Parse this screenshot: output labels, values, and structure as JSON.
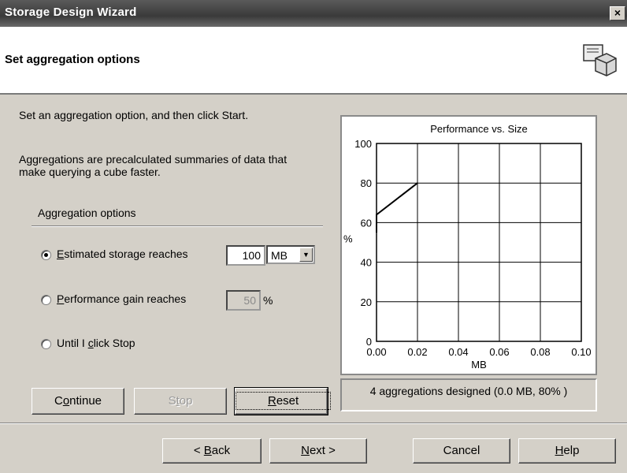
{
  "window": {
    "title": "Storage Design Wizard",
    "close": "×"
  },
  "header": {
    "title": "Set aggregation options"
  },
  "instructions": {
    "line1": "Set an aggregation option, and then click Start.",
    "line2a": "Aggregations are precalculated summaries of data that",
    "line2b": "make querying a cube faster."
  },
  "options": {
    "group_label": "Aggregation options",
    "storage": {
      "label_pre": "",
      "mnemonic": "E",
      "label_post": "stimated storage reaches",
      "value": "100",
      "unit": "MB",
      "selected": true
    },
    "performance": {
      "mnemonic": "P",
      "label_post": "erformance gain reaches",
      "value": "50",
      "unit_symbol": "%"
    },
    "until_stop": {
      "label_pre": "Until I ",
      "mnemonic": "c",
      "label_post": "lick Stop"
    }
  },
  "actions": {
    "continue": {
      "pre": "C",
      "mnemonic": "o",
      "post": "ntinue"
    },
    "stop": {
      "pre": "S",
      "mnemonic": "t",
      "post": "op"
    },
    "reset": {
      "pre": "",
      "mnemonic": "R",
      "post": "eset"
    }
  },
  "status": "4 aggregations designed (0.0 MB, 80% )",
  "footer": {
    "back": {
      "pre": "< ",
      "mnemonic": "B",
      "post": "ack"
    },
    "next": {
      "pre": "",
      "mnemonic": "N",
      "post": "ext >"
    },
    "cancel": "Cancel",
    "help": {
      "pre": "",
      "mnemonic": "H",
      "post": "elp"
    }
  },
  "chart_data": {
    "type": "line",
    "title": "Performance vs. Size",
    "xlabel": "MB",
    "ylabel": "%",
    "xlim": [
      0,
      0.1
    ],
    "ylim": [
      0,
      100
    ],
    "x_ticks": [
      "0.00",
      "0.02",
      "0.04",
      "0.06",
      "0.08",
      "0.10"
    ],
    "y_ticks": [
      "0",
      "20",
      "40",
      "60",
      "80",
      "100"
    ],
    "grid": true,
    "series": [
      {
        "x": [
          0.0,
          0.0,
          0.02
        ],
        "y": [
          55,
          64,
          80
        ]
      }
    ]
  }
}
